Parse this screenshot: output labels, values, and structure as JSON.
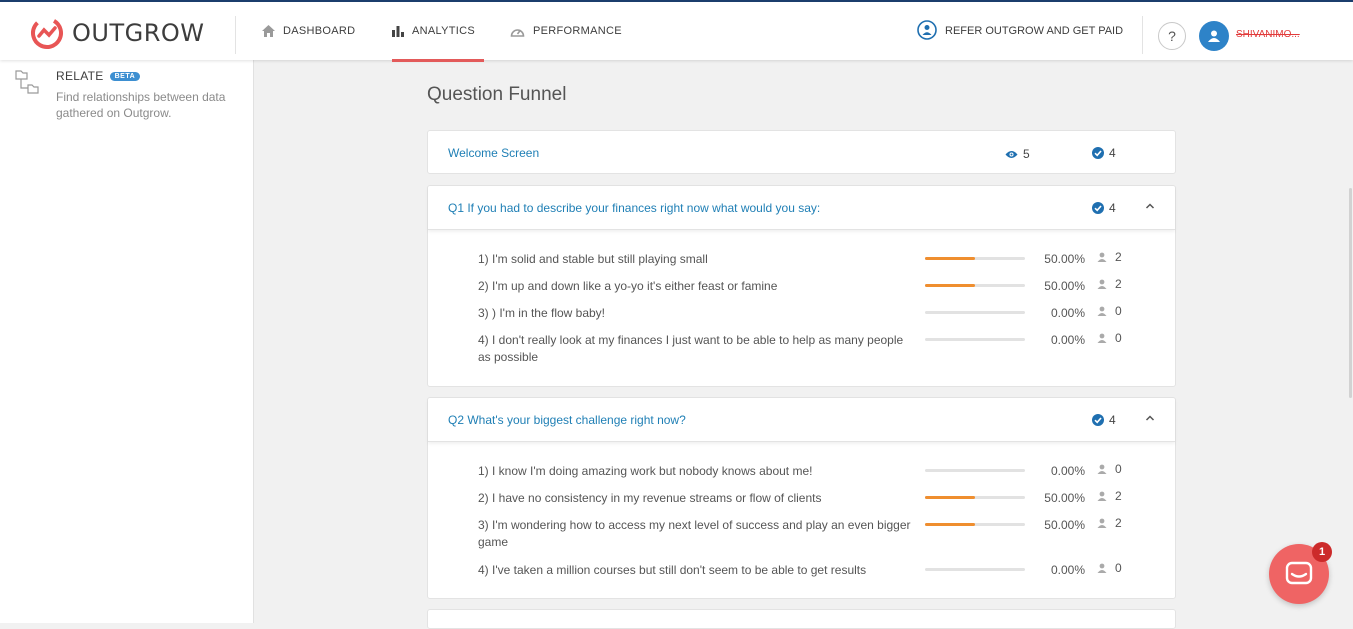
{
  "header": {
    "brand": "OUTGROW",
    "nav": [
      {
        "label": "DASHBOARD",
        "icon": "home-icon"
      },
      {
        "label": "ANALYTICS",
        "icon": "bar-chart-icon",
        "active": true
      },
      {
        "label": "PERFORMANCE",
        "icon": "speedometer-icon"
      }
    ],
    "refer_label": "REFER OUTGROW AND GET PAID",
    "help_label": "?",
    "username": "SHIVANIMO..."
  },
  "sidebar": {
    "title": "RELATE",
    "badge": "BETA",
    "description": "Find relationships between data gathered on Outgrow."
  },
  "funnel": {
    "title": "Question Funnel",
    "welcome": {
      "label": "Welcome Screen",
      "views": "5",
      "completions": "4"
    },
    "questions": [
      {
        "title": "Q1  If you had to describe your finances right now what would you say:",
        "responses": "4",
        "options": [
          {
            "text": "1)  I'm solid and stable but still playing small",
            "percent_value": 50,
            "percent": "50.00%",
            "count": "2"
          },
          {
            "text": "2)  I'm up and down like a yo-yo it's either feast or famine",
            "percent_value": 50,
            "percent": "50.00%",
            "count": "2"
          },
          {
            "text": "3)  ) I'm in the flow baby!",
            "percent_value": 0,
            "percent": "0.00%",
            "count": "0"
          },
          {
            "text": "4)  I don't really look at my finances I just want to be able to help as many people as possible",
            "percent_value": 0,
            "percent": "0.00%",
            "count": "0"
          }
        ]
      },
      {
        "title": "Q2  What's your biggest challenge right now?",
        "responses": "4",
        "options": [
          {
            "text": "1)  I know I'm doing amazing work but nobody knows about me!",
            "percent_value": 0,
            "percent": "0.00%",
            "count": "0"
          },
          {
            "text": "2)  I have no consistency in my revenue streams or flow of clients",
            "percent_value": 50,
            "percent": "50.00%",
            "count": "2"
          },
          {
            "text": "3)  I'm wondering how to access my next level of success and play an even bigger game",
            "percent_value": 50,
            "percent": "50.00%",
            "count": "2"
          },
          {
            "text": "4)  I've taken a million courses but still don't seem to be able to get results",
            "percent_value": 0,
            "percent": "0.00%",
            "count": "0"
          }
        ]
      }
    ]
  },
  "chat": {
    "badge": "1"
  },
  "colors": {
    "accent": "#e35a5a",
    "link": "#1f7fb5",
    "bar": "#ef8e2f",
    "check": "#1f6fb0"
  }
}
